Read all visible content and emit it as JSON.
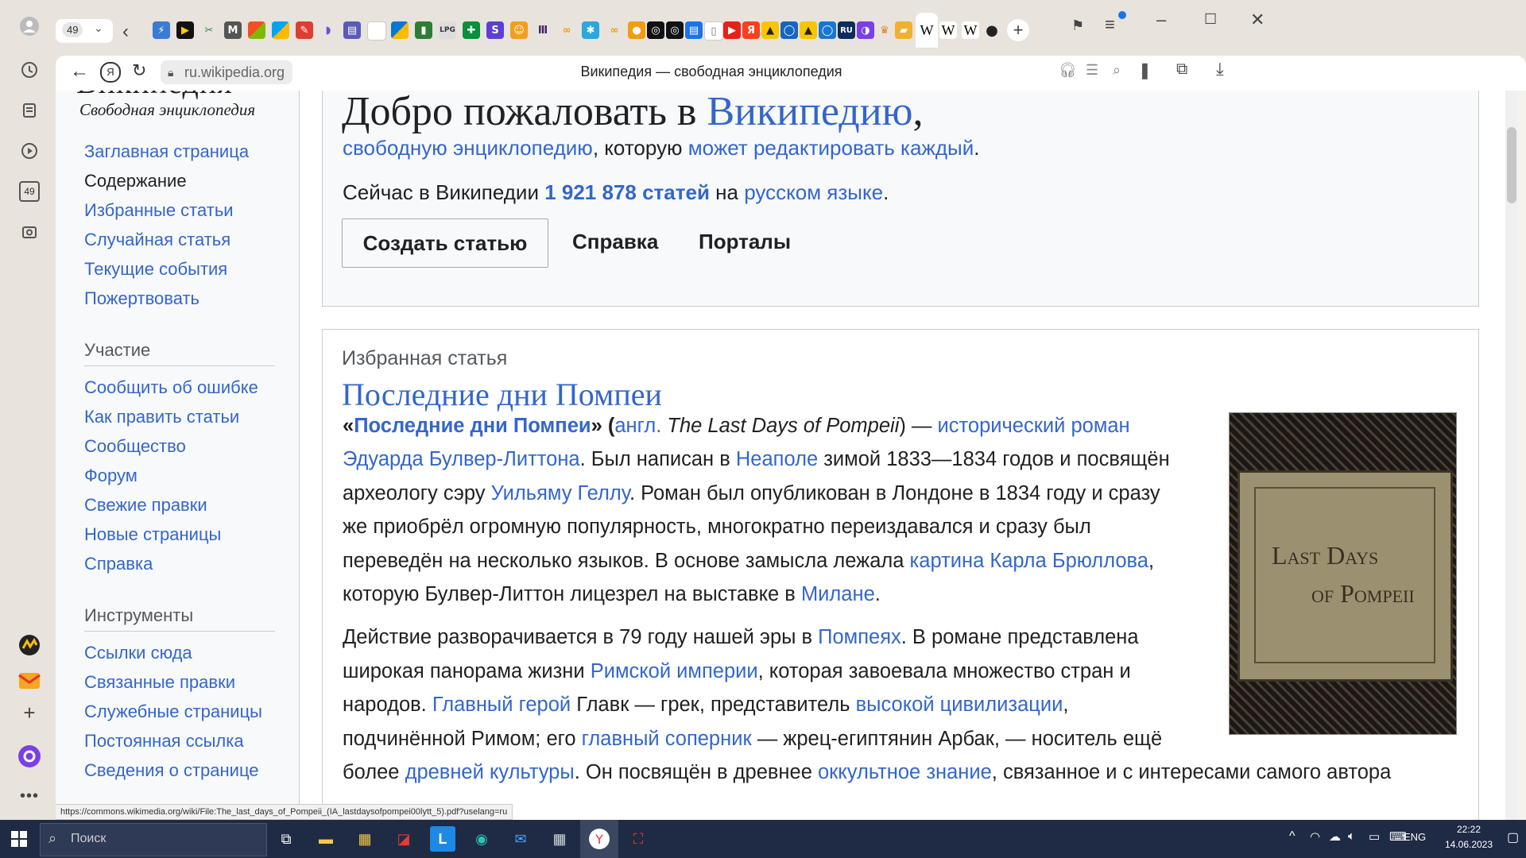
{
  "browser": {
    "tab_count": "49",
    "url": "ru.wikipedia.org",
    "page_title": "Википедия — свободная энциклопедия",
    "status_url": "https://commons.wikimedia.org/wiki/File:The_last_days_of_Pompeii_(IA_lastdaysofpompei00lytt_5).pdf?uselang=ru"
  },
  "wiki": {
    "logo_title": "Википедия",
    "logo_subtitle": "Свободная энциклопедия",
    "nav_main": [
      "Заглавная страница",
      "Содержание",
      "Избранные статьи",
      "Случайная статья",
      "Текущие события",
      "Пожертвовать"
    ],
    "participation_heading": "Участие",
    "nav_participation": [
      "Сообщить об ошибке",
      "Как править статьи",
      "Сообщество",
      "Форум",
      "Свежие правки",
      "Новые страницы",
      "Справка"
    ],
    "tools_heading": "Инструменты",
    "nav_tools": [
      "Ссылки сюда",
      "Связанные правки",
      "Служебные страницы",
      "Постоянная ссылка",
      "Сведения о странице"
    ]
  },
  "welcome": {
    "title_prefix": "Добро пожаловать в ",
    "title_link": "Википедию",
    "title_suffix": ",",
    "sub_link1": "свободную энциклопедию",
    "sub_mid": ", которую ",
    "sub_link2": "может редактировать каждый",
    "sub_end": ".",
    "count_prefix": "Сейчас в Википедии ",
    "count_link": "1 921 878 статей",
    "count_mid": " на ",
    "count_lang": "русском языке",
    "count_end": ".",
    "btn_create": "Создать статью",
    "btn_help": "Справка",
    "btn_portals": "Порталы"
  },
  "featured": {
    "label": "Избранная статья",
    "title": "Последние дни Помпеи",
    "book_line1": "Last Days",
    "book_line2": "of Pompeii",
    "p1": {
      "l1": [
        "«",
        "Последние дни Помпеи",
        "» (",
        "англ.",
        " ",
        "The Last Days of Pompeii",
        ") — ",
        "исторический роман"
      ],
      "l2": [
        "Эдуарда Булвер-Литтона",
        ". Был написан в ",
        "Неаполе",
        " зимой 1833—1834 годов и посвящён"
      ],
      "l3": [
        "археологу сэру ",
        "Уильяму Геллу",
        ". Роман был опубликован в Лондоне в 1834 году и сразу"
      ],
      "l4": "же приобрёл огромную популярность, многократно переиздавался и сразу был",
      "l5": [
        "переведён на несколько языков. В основе замысла лежала ",
        "картина Карла Брюллова",
        ","
      ],
      "l6": [
        "которую Булвер-Литтон лицезрел на выставке в ",
        "Милане",
        "."
      ]
    },
    "p2": {
      "l1": [
        "Действие разворачивается в 79 году нашей эры в ",
        "Помпеях",
        ". В романе представлена"
      ],
      "l2": [
        "широкая панорама жизни ",
        "Римской империи",
        ", которая завоевала множество стран и"
      ],
      "l3": [
        "народов. ",
        "Главный герой",
        " Главк — грек, представитель ",
        "высокой цивилизации",
        ","
      ],
      "l4": [
        "подчинённой Римом; его ",
        "главный соперник",
        " — жрец-египтянин Арбак, — носитель ещё"
      ],
      "l5": [
        "более ",
        "древней культуры",
        ". Он посвящён в древнее ",
        "оккультное знание",
        ", связанное и с интересами самого автора"
      ]
    }
  },
  "taskbar": {
    "search_placeholder": "Поиск",
    "lang": "ENG",
    "time": "22:22",
    "date": "14.06.2023"
  },
  "colors": {
    "link": "#3366cc",
    "text": "#202122",
    "nav_bg": "#f8f9fa",
    "border": "#c8ccd1",
    "taskbar": "#1f2a44"
  }
}
